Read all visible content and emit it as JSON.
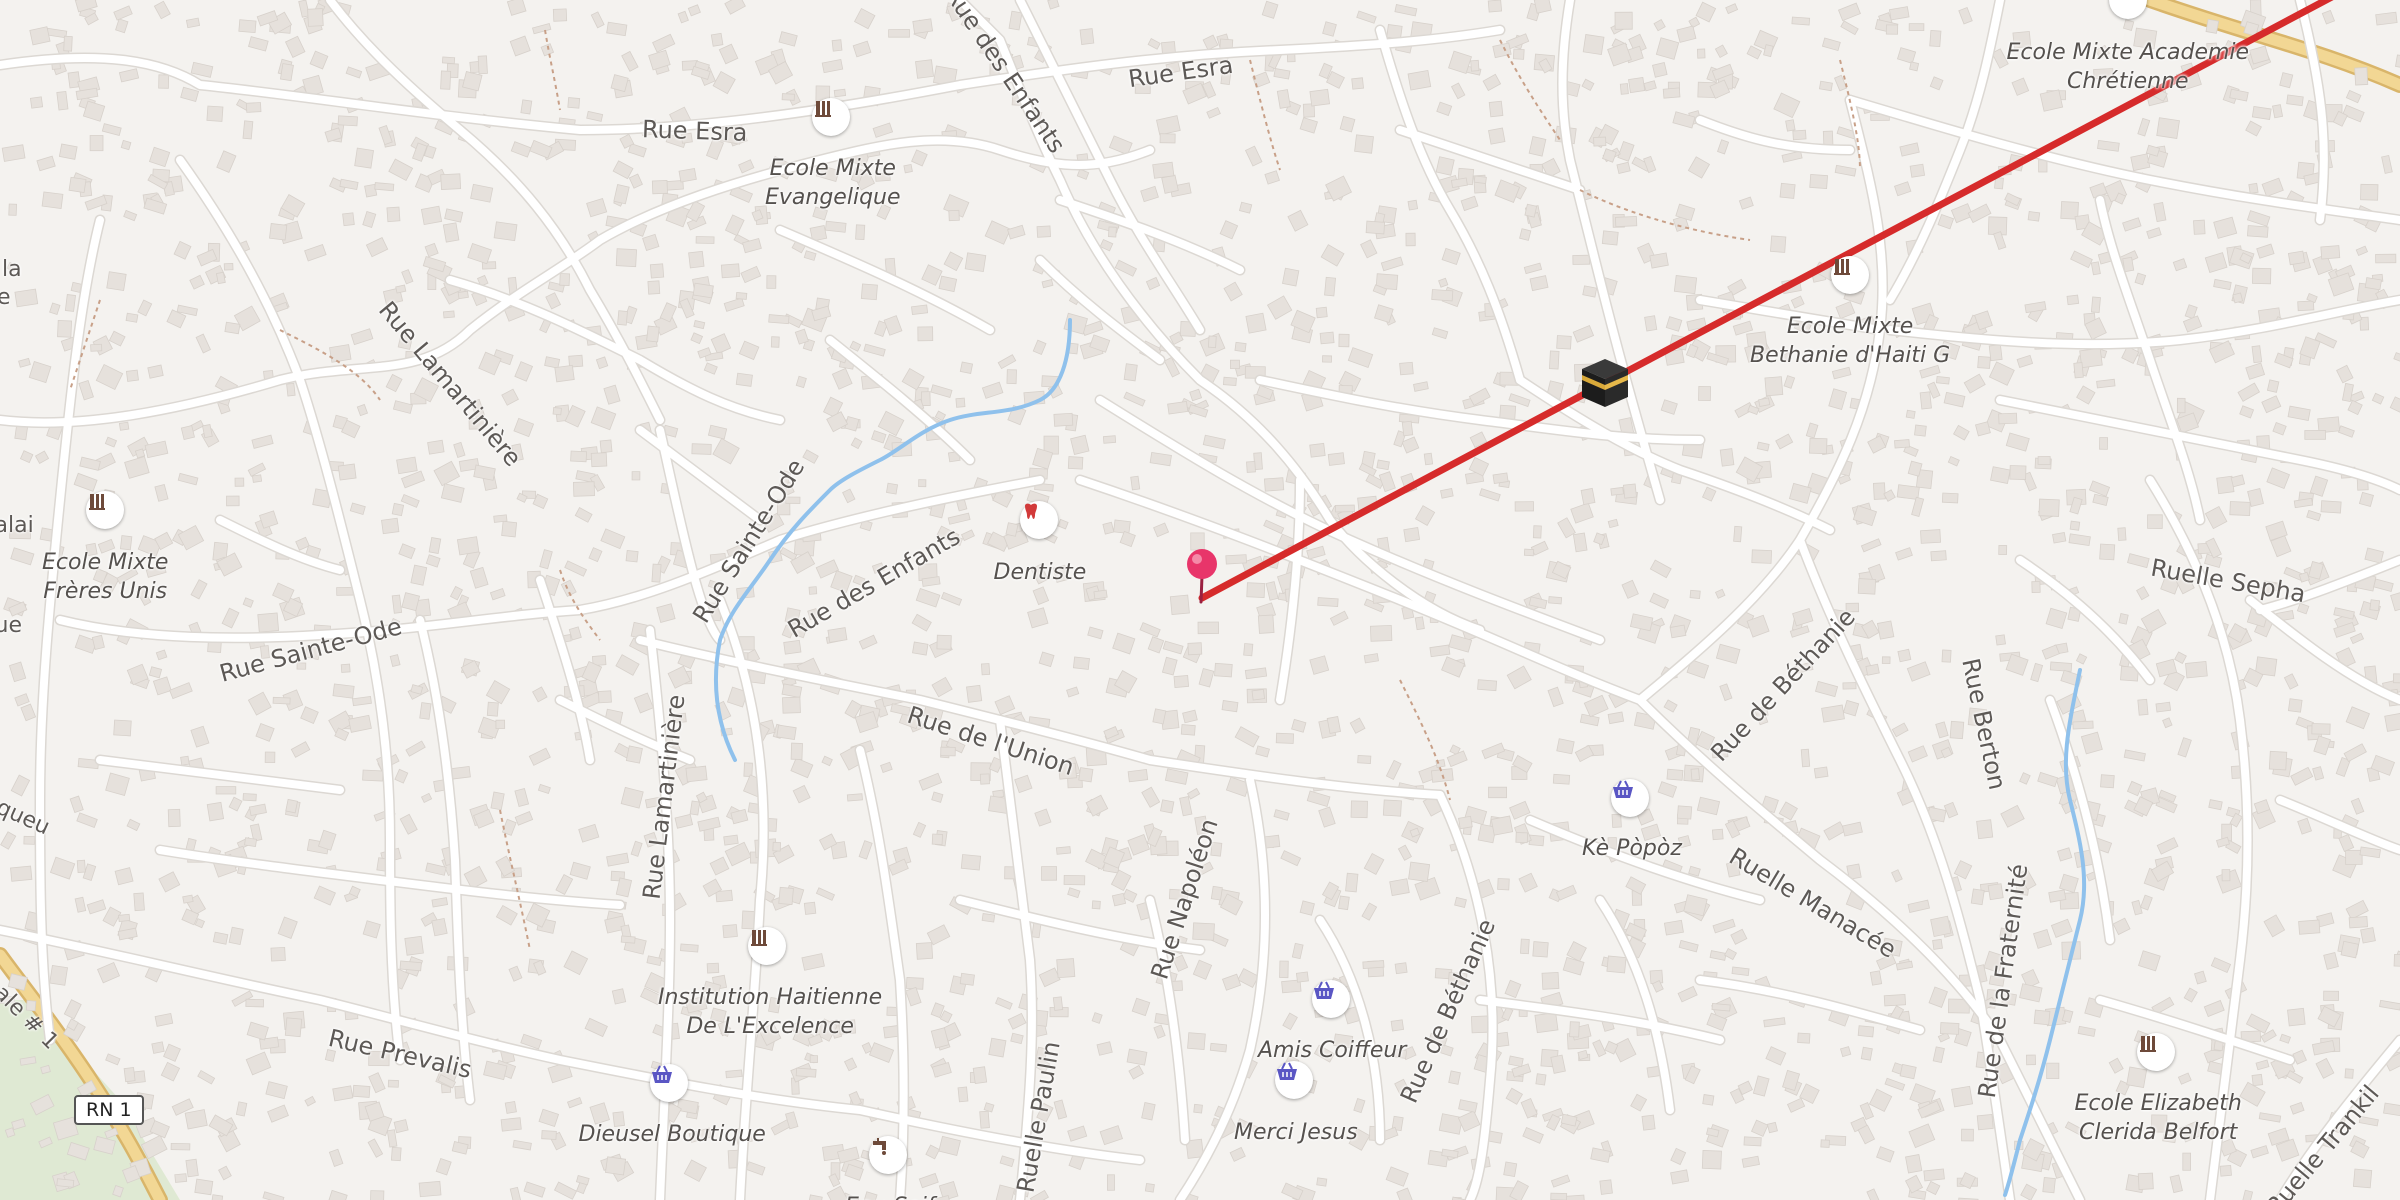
{
  "map": {
    "colors": {
      "background": "#f4f2ef",
      "road": "#ffffff",
      "road_casing": "#dcd8d3",
      "building": "#e6e1dc",
      "water": "#8fc1ec",
      "path": "#c8a088",
      "highway": "#f2d794",
      "park": "#dfe9d3",
      "route_line": "#d62b2b",
      "pin": "#e8356a",
      "poi_blue": "#5a56c4",
      "poi_brown": "#6e4a3a",
      "poi_red": "#d23a3a"
    },
    "streets": [
      {
        "id": "rue-esra-west",
        "name": "Rue Esra"
      },
      {
        "id": "rue-esra-east",
        "name": "Rue Esra"
      },
      {
        "id": "rue-des-enfants-north",
        "name": "Rue des Enfants"
      },
      {
        "id": "rue-des-enfants",
        "name": "Rue des Enfants"
      },
      {
        "id": "rue-lamartiniere-north",
        "name": "Rue Lamartinière"
      },
      {
        "id": "rue-lamartiniere-south",
        "name": "Rue Lamartinière"
      },
      {
        "id": "rue-sainte-ode-west",
        "name": "Rue Sainte-Ode"
      },
      {
        "id": "rue-sainte-ode",
        "name": "Rue Sainte-Ode"
      },
      {
        "id": "rue-de-l-union",
        "name": "Rue de l'Union"
      },
      {
        "id": "rue-napoleon",
        "name": "Rue Napoléon"
      },
      {
        "id": "ruelle-paulin",
        "name": "Ruelle Paulin"
      },
      {
        "id": "rue-prevalis",
        "name": "Rue Prevalis"
      },
      {
        "id": "rue-de-bethanie-north",
        "name": "Rue de Béthanie"
      },
      {
        "id": "rue-de-bethanie-south",
        "name": "Rue de Béthanie"
      },
      {
        "id": "rue-berton",
        "name": "Rue Berton"
      },
      {
        "id": "ruelle-manacee",
        "name": "Ruelle Manacée"
      },
      {
        "id": "rue-de-la-fraternite",
        "name": "Rue de la Fraternité"
      },
      {
        "id": "ruelle-sepha",
        "name": "Ruelle Sepha"
      },
      {
        "id": "ruelle-trankil",
        "name": "Ruelle Trankil"
      },
      {
        "id": "edge-la",
        "name": "la"
      },
      {
        "id": "edge-e",
        "name": "e"
      },
      {
        "id": "edge-alai",
        "name": "alai"
      },
      {
        "id": "edge-ue",
        "name": "ue"
      },
      {
        "id": "edge-queu",
        "name": "queu"
      },
      {
        "id": "edge-ale-1",
        "name": "ale # 1"
      }
    ],
    "pois": [
      {
        "id": "ecole-mixte-evangelique",
        "lines": [
          "Ecole Mixte",
          "Evangelique"
        ],
        "icon": "school-icon"
      },
      {
        "id": "ecole-mixte-freres-unis",
        "lines": [
          "Ecole Mixte",
          "Frères Unis"
        ],
        "icon": "school-icon"
      },
      {
        "id": "dentiste",
        "lines": [
          "Dentiste"
        ],
        "icon": "tooth-icon"
      },
      {
        "id": "ecole-mixte-academie",
        "lines": [
          "Ecole Mixte Academie",
          "Chrétienne"
        ],
        "icon": "school-icon"
      },
      {
        "id": "ecole-mixte-bethanie",
        "lines": [
          "Ecole Mixte",
          "Bethanie d'Haiti G"
        ],
        "icon": "school-icon"
      },
      {
        "id": "ke-popoz",
        "lines": [
          "Kè Pòpòz"
        ],
        "icon": "shopping-basket-icon"
      },
      {
        "id": "institution-haitienne",
        "lines": [
          "Institution Haitienne",
          "De L'Excelence"
        ],
        "icon": "school-icon"
      },
      {
        "id": "amis-coiffeur",
        "lines": [
          "Amis Coiffeur"
        ],
        "icon": "shopping-basket-icon"
      },
      {
        "id": "merci-jesus",
        "lines": [
          "Merci Jesus"
        ],
        "icon": "shopping-basket-icon"
      },
      {
        "id": "dieusel-boutique",
        "lines": [
          "Dieusel Boutique"
        ],
        "icon": "shopping-basket-icon"
      },
      {
        "id": "eau-soif",
        "lines": [
          "Eau Soif"
        ],
        "icon": "water-tap-icon"
      },
      {
        "id": "ecole-elizabeth",
        "lines": [
          "Ecole Elizabeth",
          "Clerida Belfort"
        ],
        "icon": "school-icon"
      }
    ],
    "route_shield": "RN 1",
    "qibla_icon": "kaaba-icon",
    "pin_icon": "location-pin-icon"
  }
}
